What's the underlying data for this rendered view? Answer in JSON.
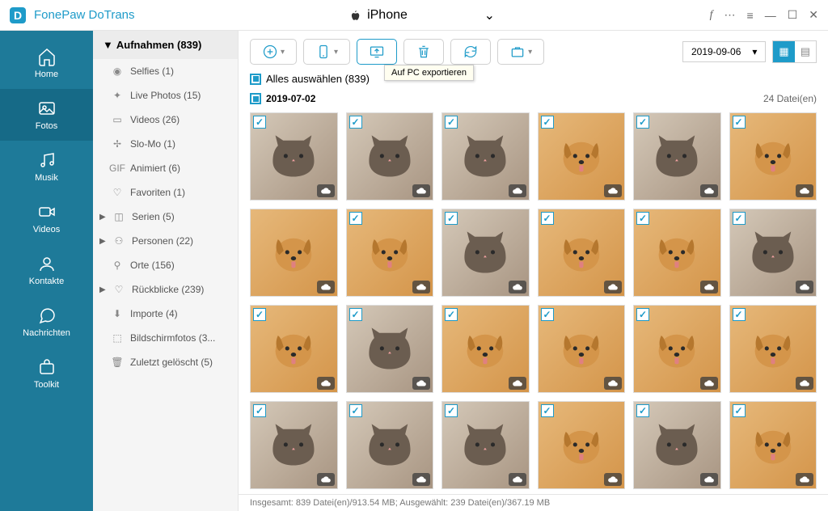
{
  "app_title": "FonePaw DoTrans",
  "device": "iPhone",
  "sidebar": {
    "items": [
      {
        "label": "Home"
      },
      {
        "label": "Fotos"
      },
      {
        "label": "Musik"
      },
      {
        "label": "Videos"
      },
      {
        "label": "Kontakte"
      },
      {
        "label": "Nachrichten"
      },
      {
        "label": "Toolkit"
      }
    ]
  },
  "categories": {
    "header": "Aufnahmen (839)",
    "items": [
      {
        "label": "Selfies (1)"
      },
      {
        "label": "Live Photos (15)"
      },
      {
        "label": "Videos (26)"
      },
      {
        "label": "Slo-Mo (1)"
      },
      {
        "label": "Animiert (6)"
      },
      {
        "label": "Favoriten (1)"
      },
      {
        "label": "Serien (5)",
        "arrow": true
      },
      {
        "label": "Personen (22)",
        "arrow": true
      },
      {
        "label": "Orte (156)"
      },
      {
        "label": "Rückblicke (239)",
        "arrow": true
      },
      {
        "label": "Importe (4)"
      },
      {
        "label": "Bildschirmfotos (3..."
      },
      {
        "label": "Zuletzt gelöscht (5)"
      }
    ]
  },
  "toolbar": {
    "tooltip": "Auf PC exportieren",
    "date": "2019-09-06"
  },
  "selectall": "Alles auswählen (839)",
  "group": {
    "date": "2019-07-02",
    "count": "24 Datei(en)"
  },
  "thumbs": [
    {
      "t": "cat",
      "c": true
    },
    {
      "t": "cat",
      "c": true
    },
    {
      "t": "cat",
      "c": true
    },
    {
      "t": "dog",
      "c": true
    },
    {
      "t": "cat",
      "c": true
    },
    {
      "t": "dog",
      "c": true
    },
    {
      "t": "dog",
      "c": false
    },
    {
      "t": "dog",
      "c": true
    },
    {
      "t": "cat",
      "c": true
    },
    {
      "t": "dog",
      "c": true
    },
    {
      "t": "dog",
      "c": true
    },
    {
      "t": "cat",
      "c": true
    },
    {
      "t": "dog",
      "c": true
    },
    {
      "t": "cat",
      "c": true
    },
    {
      "t": "dog",
      "c": true
    },
    {
      "t": "dog",
      "c": true
    },
    {
      "t": "dog",
      "c": true
    },
    {
      "t": "dog",
      "c": true
    },
    {
      "t": "cat",
      "c": true
    },
    {
      "t": "cat",
      "c": true
    },
    {
      "t": "cat",
      "c": true
    },
    {
      "t": "dog",
      "c": true
    },
    {
      "t": "cat",
      "c": true
    },
    {
      "t": "dog",
      "c": true
    }
  ],
  "status": "Insgesamt: 839 Datei(en)/913.54 MB; Ausgewählt: 239 Datei(en)/367.19 MB"
}
